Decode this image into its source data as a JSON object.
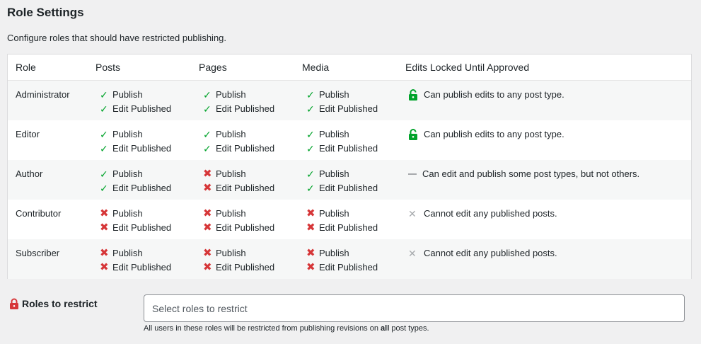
{
  "header": {
    "title": "Role Settings",
    "description": "Configure roles that should have restricted publishing."
  },
  "table": {
    "columns": [
      "Role",
      "Posts",
      "Pages",
      "Media",
      "Edits Locked Until Approved"
    ],
    "perm_labels": {
      "publish": "Publish",
      "edit": "Edit Published"
    },
    "rows": [
      {
        "role": "Administrator",
        "posts": {
          "publish": true,
          "edit": true
        },
        "pages": {
          "publish": true,
          "edit": true
        },
        "media": {
          "publish": true,
          "edit": true
        },
        "lock_status": "unlocked",
        "lock_text": "Can publish edits to any post type."
      },
      {
        "role": "Editor",
        "posts": {
          "publish": true,
          "edit": true
        },
        "pages": {
          "publish": true,
          "edit": true
        },
        "media": {
          "publish": true,
          "edit": true
        },
        "lock_status": "unlocked",
        "lock_text": "Can publish edits to any post type."
      },
      {
        "role": "Author",
        "posts": {
          "publish": true,
          "edit": true
        },
        "pages": {
          "publish": false,
          "edit": false
        },
        "media": {
          "publish": true,
          "edit": true
        },
        "lock_status": "partial",
        "lock_text": "Can edit and publish some post types, but not others."
      },
      {
        "role": "Contributor",
        "posts": {
          "publish": false,
          "edit": false
        },
        "pages": {
          "publish": false,
          "edit": false
        },
        "media": {
          "publish": false,
          "edit": false
        },
        "lock_status": "none",
        "lock_text": "Cannot edit any published posts."
      },
      {
        "role": "Subscriber",
        "posts": {
          "publish": false,
          "edit": false
        },
        "pages": {
          "publish": false,
          "edit": false
        },
        "media": {
          "publish": false,
          "edit": false
        },
        "lock_status": "none",
        "lock_text": "Cannot edit any published posts."
      }
    ]
  },
  "restrict": {
    "label": "Roles to restrict",
    "placeholder": "Select roles to restrict",
    "help_prefix": "All users in these roles will be restricted from publishing revisions on ",
    "help_bold": "all",
    "help_suffix": " post types."
  },
  "colors": {
    "ok": "#00a32a",
    "no": "#d63638",
    "unlock": "#00a32a",
    "lock": "#d63638",
    "muted": "#a7aaad"
  },
  "icons": {
    "ok": "checkmark-icon",
    "no": "cross-icon",
    "unlocked": "unlocked-padlock-icon",
    "partial": "dash-icon",
    "none": "grey-x-icon",
    "locked": "locked-padlock-icon"
  }
}
